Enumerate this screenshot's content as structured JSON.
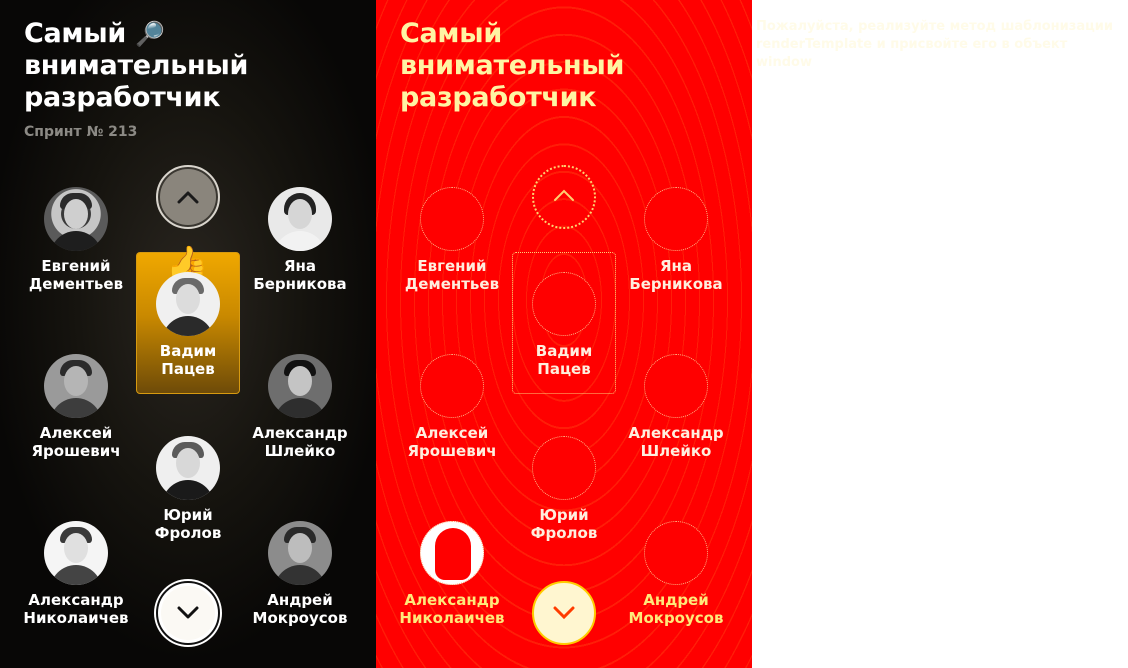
{
  "title_line1": "Самый",
  "title_line2": "внимательный",
  "title_line3": "разработчик",
  "title_emoji": "🔎",
  "title_emoji_icon": "magnifying-glass-icon",
  "subtitle": "Спринт № 213",
  "winner_badge_emoji": "👍",
  "winner_badge_icon": "thumbs-up-icon",
  "nav": {
    "up_icon": "chevron-up-icon",
    "down_icon": "chevron-down-icon"
  },
  "people": [
    {
      "first": "Евгений",
      "last": "Дементьев"
    },
    {
      "first": "Яна",
      "last": "Берникова"
    },
    {
      "first": "Вадим",
      "last": "Пацев",
      "winner": true
    },
    {
      "first": "Алексей",
      "last": "Ярошевич"
    },
    {
      "first": "Александр",
      "last": "Шлейко"
    },
    {
      "first": "Юрий",
      "last": "Фролов"
    },
    {
      "first": "Александр",
      "last": "Николаичев"
    },
    {
      "first": "Андрей",
      "last": "Мокроусов"
    }
  ],
  "notice_line1": "Пожалуйста, реализуйте метод шаблонизации",
  "notice_line2": "renderTemplate и присвойте его в объект window",
  "colors": {
    "accent_gold": "#f0a800",
    "mid_panel_red": "#ff0000",
    "left_panel_bg": "#0b0a08"
  }
}
